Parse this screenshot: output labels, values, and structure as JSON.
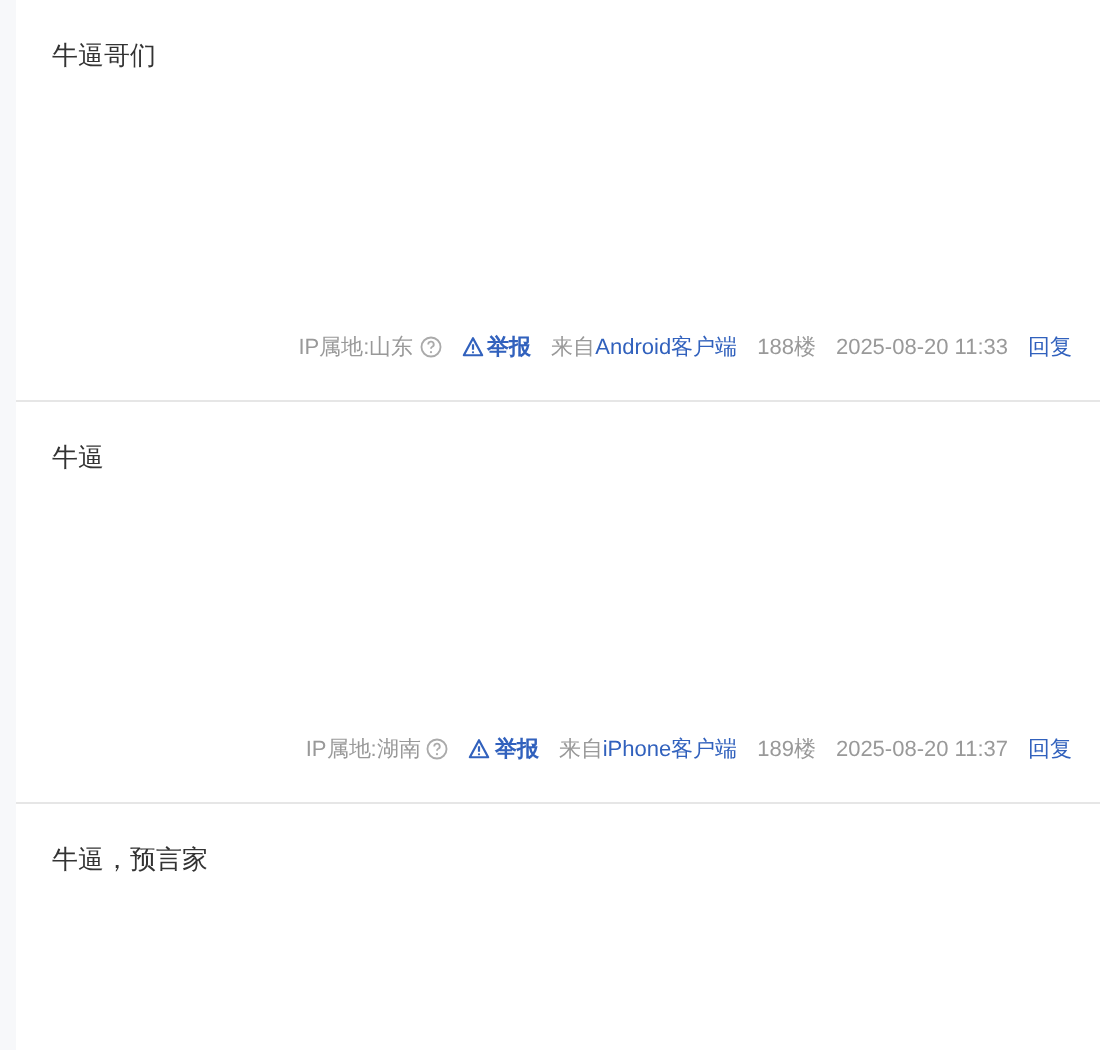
{
  "posts": [
    {
      "text": "牛逼哥们",
      "meta": {
        "ip": "IP属地:山东",
        "report": "举报",
        "source_prefix": "来自",
        "client": "Android客户端",
        "floor": "188楼",
        "time": "2025-08-20 11:33",
        "reply": "回复"
      }
    },
    {
      "text": "牛逼",
      "meta": {
        "ip": "IP属地:湖南",
        "report": "举报",
        "source_prefix": "来自",
        "client": "iPhone客户端",
        "floor": "189楼",
        "time": "2025-08-20 11:37",
        "reply": "回复"
      }
    },
    {
      "text": "牛逼，预言家"
    }
  ]
}
